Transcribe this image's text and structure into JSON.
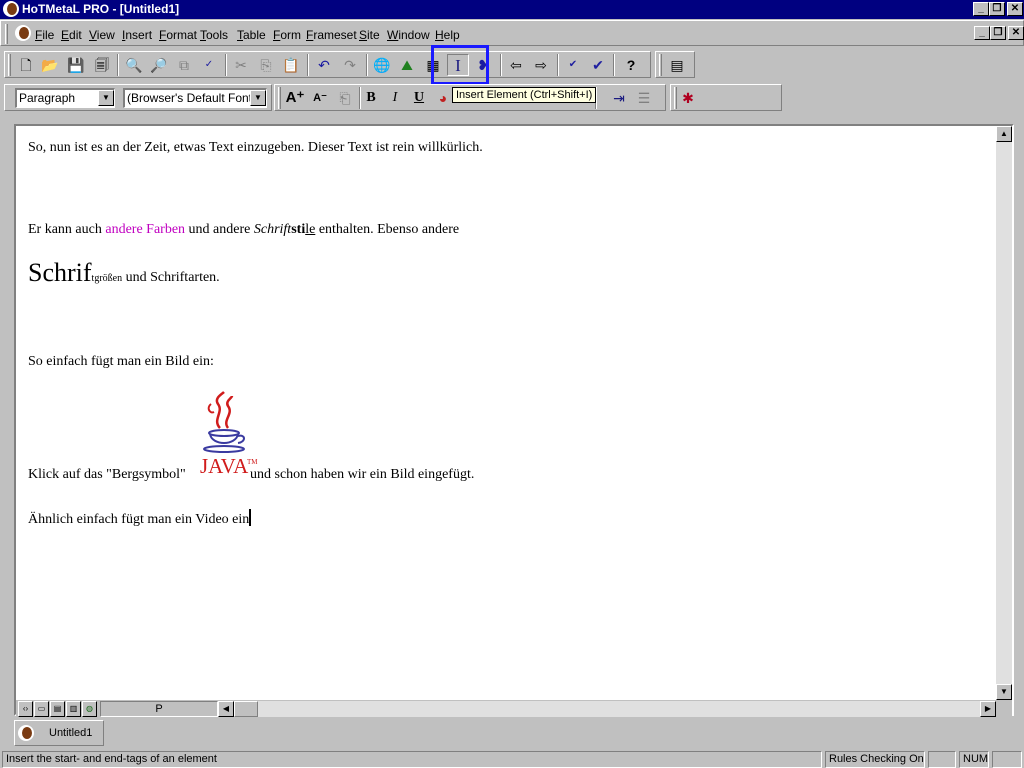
{
  "window": {
    "title": "HoTMetaL PRO - [Untitled1]"
  },
  "menu": [
    "File",
    "Edit",
    "View",
    "Insert",
    "Format",
    "Tools",
    "Table",
    "Form",
    "Frameset",
    "Site",
    "Window",
    "Help"
  ],
  "toolbar": {
    "paragraph_style": "Paragraph",
    "font": "(Browser's Default Font)",
    "bold": "B",
    "italic": "I",
    "underline": "U",
    "help": "?",
    "insert_element_glyph": "I"
  },
  "tooltip": "Insert Element (Ctrl+Shift+I)",
  "document": {
    "p1": "So, nun ist es an der Zeit, etwas Text einzugeben. Dieser Text ist rein willkürlich.",
    "p2_a": "Er kann auch ",
    "p2_colored": "andere Farben",
    "p2_b": " und andere ",
    "p2_italic": "Schrift",
    "p2_bold": "sti",
    "p2_under": "le",
    "p2_c": " enthalten. Ebenso andere",
    "p3_big": "Schrif",
    "p3_small": "tgrößen",
    "p3_rest": " und Schriftarten.",
    "p4": "So einfach fügt man ein Bild ein:",
    "p5_a": "Klick auf das \"Bergsymbol\"",
    "p5_logo": "JAVA",
    "p5_logo_tm": "TM",
    "p5_b": "und schon haben wir ein Bild eingefügt.",
    "p6": "Ähnlich einfach fügt man ein Video ein"
  },
  "hscroll_label": "P",
  "tab": {
    "label": "Untitled1"
  },
  "status": {
    "message": "Insert the start- and end-tags of an element",
    "rules": "Rules Checking On",
    "num": "NUM"
  },
  "colors": {
    "titlebar": "#000080",
    "highlight": "#1a1aff",
    "colored_text": "#c000c0",
    "java_red": "#d01c1c",
    "java_blue": "#3a3aa0"
  }
}
